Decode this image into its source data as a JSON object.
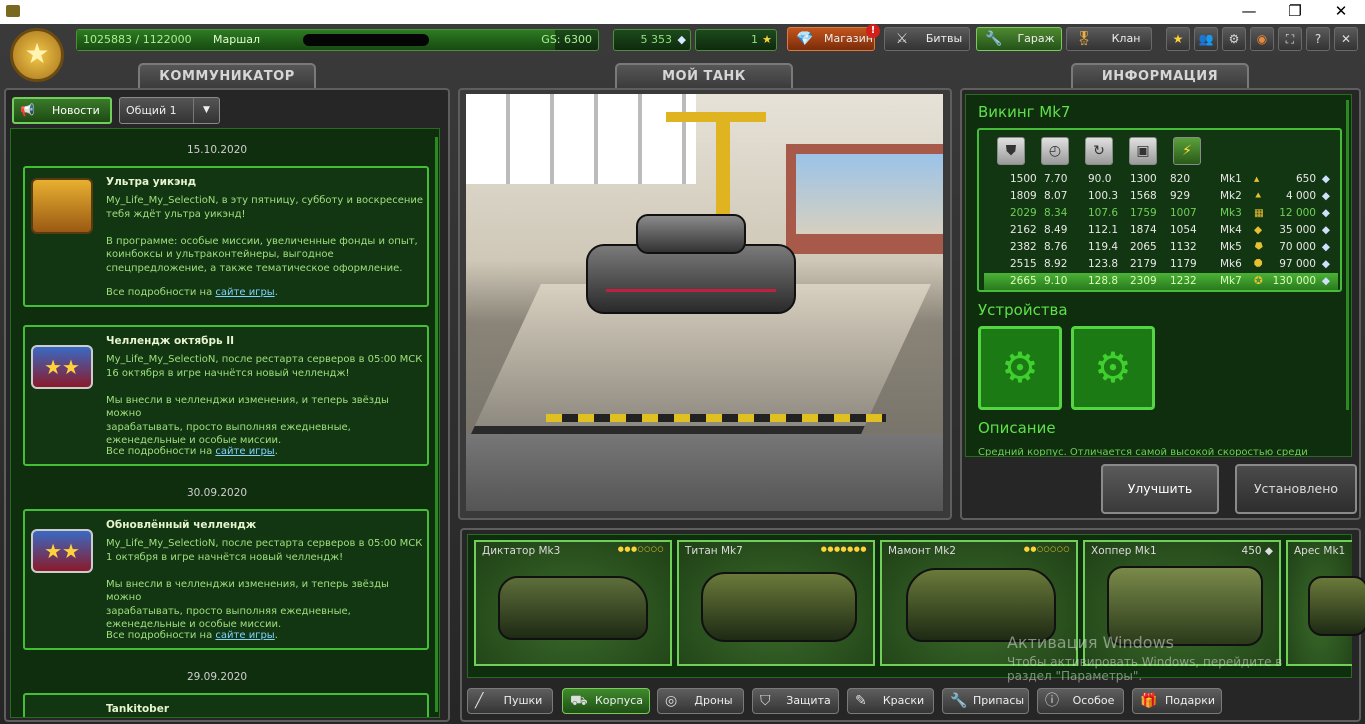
{
  "window": {
    "minimize": "—",
    "maximize": "❐",
    "close": "✕"
  },
  "topbar": {
    "experience": "1025883 / 1122000",
    "rank": "Маршал",
    "gearscore": "GS: 6300",
    "crystals": "5 353",
    "stars": "1",
    "shop": "Магазин",
    "shop_alert": "!",
    "battles": "Битвы",
    "garage": "Гараж",
    "clan": "Клан"
  },
  "headers": {
    "communicator": "КОММУНИКАТОР",
    "my_tank": "МОЙ ТАНК",
    "info": "ИНФОРМАЦИЯ"
  },
  "communicator": {
    "news_button": "Новости",
    "channel": "Общий 1"
  },
  "feed": [
    {
      "date": "15.10.2020",
      "title": "Ультра уикэнд",
      "body": "My_Life_My_SelectioN, в эту пятницу, субботу и воскресение\nтебя ждёт ультра уикэнд!\n\nВ программе: особые миссии, увеличенные фонды и опыт,\nкоинбоксы и ультраконтейнеры, выгодное\nспецпредложение, а также тематическое оформление.",
      "more": "Все подробности на",
      "link": "сайте игры",
      "tail": "."
    },
    {
      "title": "Челлендж октябрь II",
      "body": "My_Life_My_SelectioN, после рестарта серверов в 05:00 МСК\n16 октября в игре начнётся новый челлендж!\n\nМы внесли в челленджи изменения, и теперь звёзды можно\nзарабатывать, просто выполняя ежедневные,\nеженедельные и особые миссии.",
      "more": "Все подробности на",
      "link": "сайте игры",
      "tail": "."
    },
    {
      "date": "30.09.2020",
      "title": "Обновлённый челлендж",
      "body": "My_Life_My_SelectioN, после рестарта серверов в 05:00 МСК\n1 октября в игре начнётся новый челлендж!\n\nМы внесли в челленджи изменения, и теперь звёзды можно\nзарабатывать, просто выполняя ежедневные,\nеженедельные и особые миссии.",
      "more": "Все подробности на",
      "link": "сайте игры",
      "tail": "."
    },
    {
      "date": "29.09.2020",
      "title": "Tankitober"
    }
  ],
  "info": {
    "title": "Викинг Mk7",
    "stat_icons": [
      "armor-icon",
      "speed-icon",
      "turn-icon",
      "weight-icon",
      "power-icon"
    ],
    "rows": [
      {
        "v": [
          "1500",
          "7.70",
          "90.0",
          "1300",
          "820"
        ],
        "mk": "Mk1",
        "price": "650"
      },
      {
        "v": [
          "1809",
          "8.07",
          "100.3",
          "1568",
          "929"
        ],
        "mk": "Mk2",
        "price": "4 000"
      },
      {
        "v": [
          "2029",
          "8.34",
          "107.6",
          "1759",
          "1007"
        ],
        "mk": "Mk3",
        "price": "12 000"
      },
      {
        "v": [
          "2162",
          "8.49",
          "112.1",
          "1874",
          "1054"
        ],
        "mk": "Mk4",
        "price": "35 000"
      },
      {
        "v": [
          "2382",
          "8.76",
          "119.4",
          "2065",
          "1132"
        ],
        "mk": "Mk5",
        "price": "70 000"
      },
      {
        "v": [
          "2515",
          "8.92",
          "123.8",
          "2179",
          "1179"
        ],
        "mk": "Mk6",
        "price": "97 000"
      },
      {
        "v": [
          "2665",
          "9.10",
          "128.8",
          "2309",
          "1232"
        ],
        "mk": "Mk7",
        "price": "130 000"
      }
    ],
    "devices_title": "Устройства",
    "description_title": "Описание",
    "description_text": "Средний корпус. Отличается самой высокой скоростью среди"
  },
  "actions": {
    "upgrade": "Улучшить",
    "installed": "Установлено"
  },
  "cards": [
    {
      "name": "Диктатор Mk3",
      "stars": "●●●○○○○"
    },
    {
      "name": "Титан Mk7",
      "stars": "●●●●●●●"
    },
    {
      "name": "Мамонт Mk2",
      "stars": "●●○○○○○"
    },
    {
      "name": "Хоппер Mk1",
      "price": "450"
    },
    {
      "name": "Арес Mk1"
    }
  ],
  "tabs": [
    "Пушки",
    "Корпуса",
    "Дроны",
    "Защита",
    "Краски",
    "Припасы",
    "Особое",
    "Подарки"
  ],
  "watermark": {
    "title": "Активация Windows",
    "line1": "Чтобы активировать Windows, перейдите в",
    "line2": "раздел \"Параметры\"."
  }
}
